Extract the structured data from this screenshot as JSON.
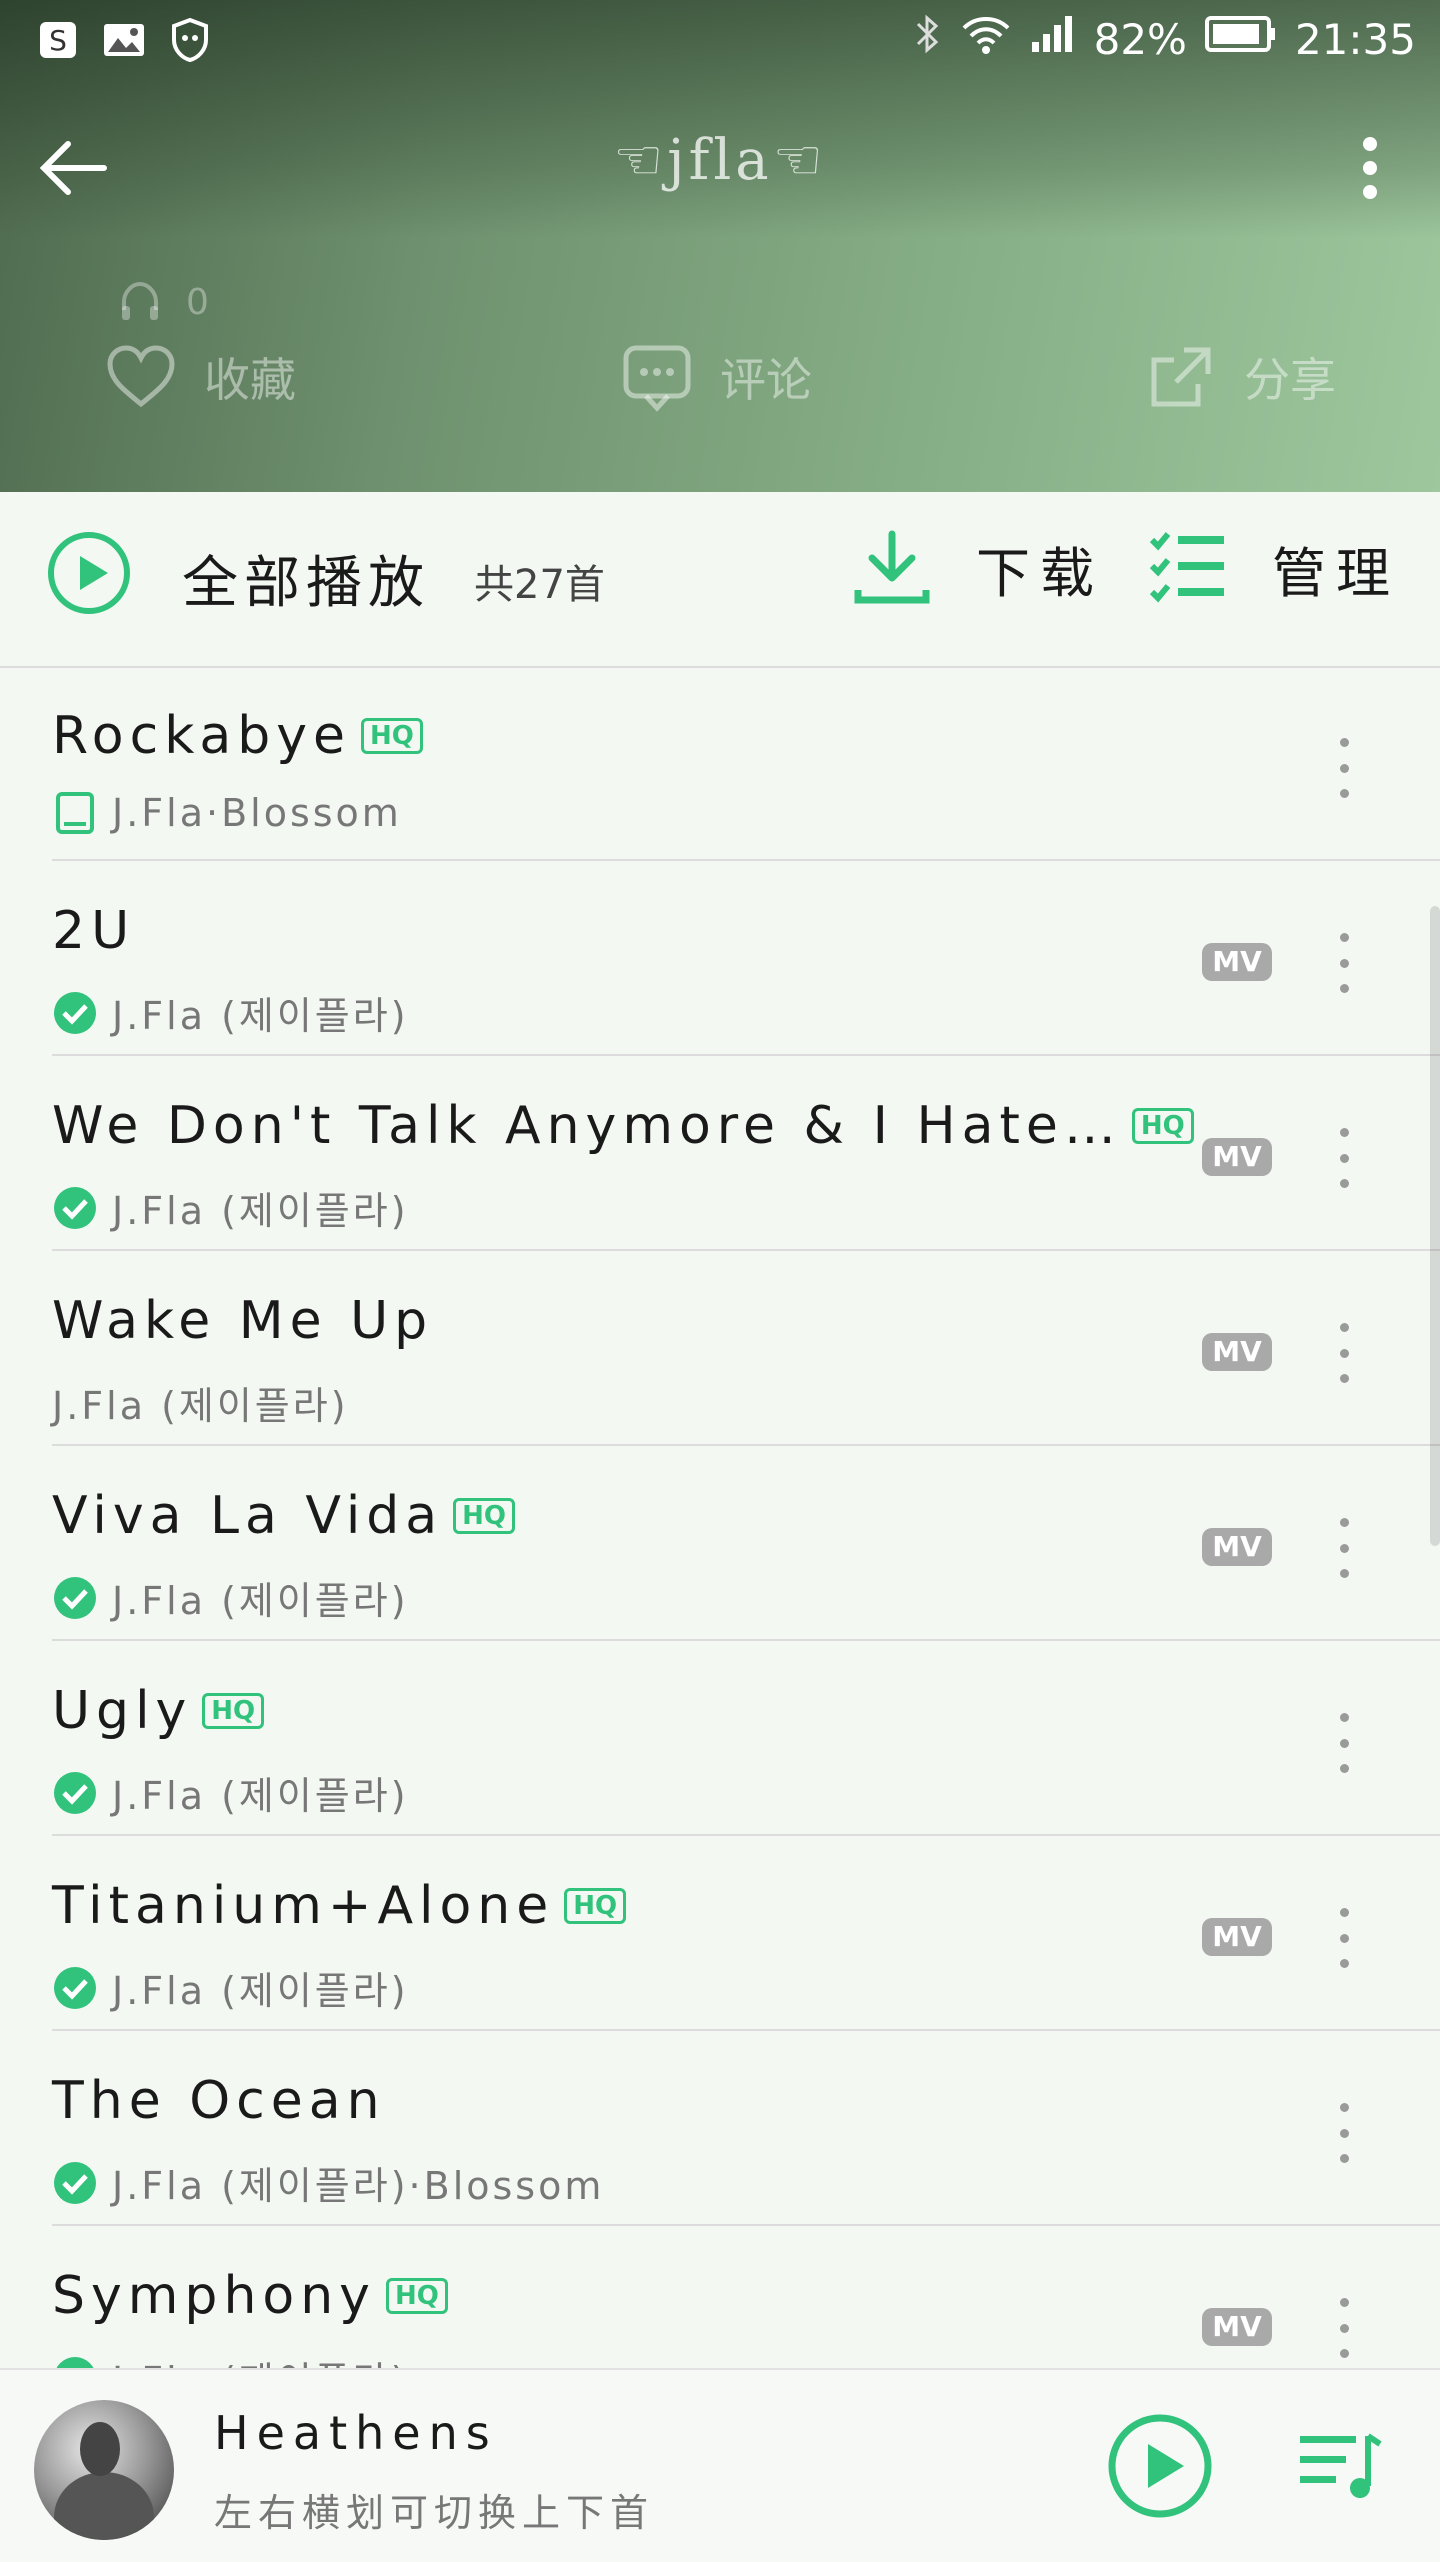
{
  "status_bar": {
    "battery": "82%",
    "time": "21:35"
  },
  "toolbar": {
    "title": "☜jfla☜",
    "listen_count": "0"
  },
  "actions": {
    "favorite": "收藏",
    "comment": "评论",
    "share": "分享"
  },
  "play_all": {
    "label": "全部播放",
    "count": "共27首",
    "download": "下载",
    "manage": "管理"
  },
  "songs": [
    {
      "title": "Rockabye",
      "hq": "HQ",
      "artist": "J.Fla·Blossom",
      "status": "local"
    },
    {
      "title": "2U",
      "artist": "J.Fla (제이플라)",
      "mv": "MV",
      "status": "downloaded"
    },
    {
      "title": "We Don't Talk Anymore & I Hate…",
      "hq": "HQ",
      "artist": "J.Fla (제이플라)",
      "mv": "MV",
      "status": "downloaded"
    },
    {
      "title": "Wake Me Up",
      "artist": "J.Fla (제이플라)",
      "mv": "MV",
      "status": "none"
    },
    {
      "title": "Viva La Vida",
      "hq": "HQ",
      "artist": "J.Fla (제이플라)",
      "mv": "MV",
      "status": "downloaded"
    },
    {
      "title": "Ugly",
      "hq": "HQ",
      "artist": "J.Fla (제이플라)",
      "status": "downloaded"
    },
    {
      "title": "Titanium+Alone",
      "hq": "HQ",
      "artist": "J.Fla (제이플라)",
      "mv": "MV",
      "status": "downloaded"
    },
    {
      "title": "The Ocean",
      "artist": "J.Fla (제이플라)·Blossom",
      "status": "downloaded"
    },
    {
      "title": "Symphony",
      "hq": "HQ",
      "artist": "J.Fla (제이플라)",
      "mv": "MV",
      "status": "downloaded"
    }
  ],
  "mini_player": {
    "track": "Heathens",
    "hint": "左右横划可切换上下首"
  },
  "colors": {
    "accent": "#31c27c",
    "header_start": "#4f6a4f",
    "header_end": "#9ec79e"
  }
}
